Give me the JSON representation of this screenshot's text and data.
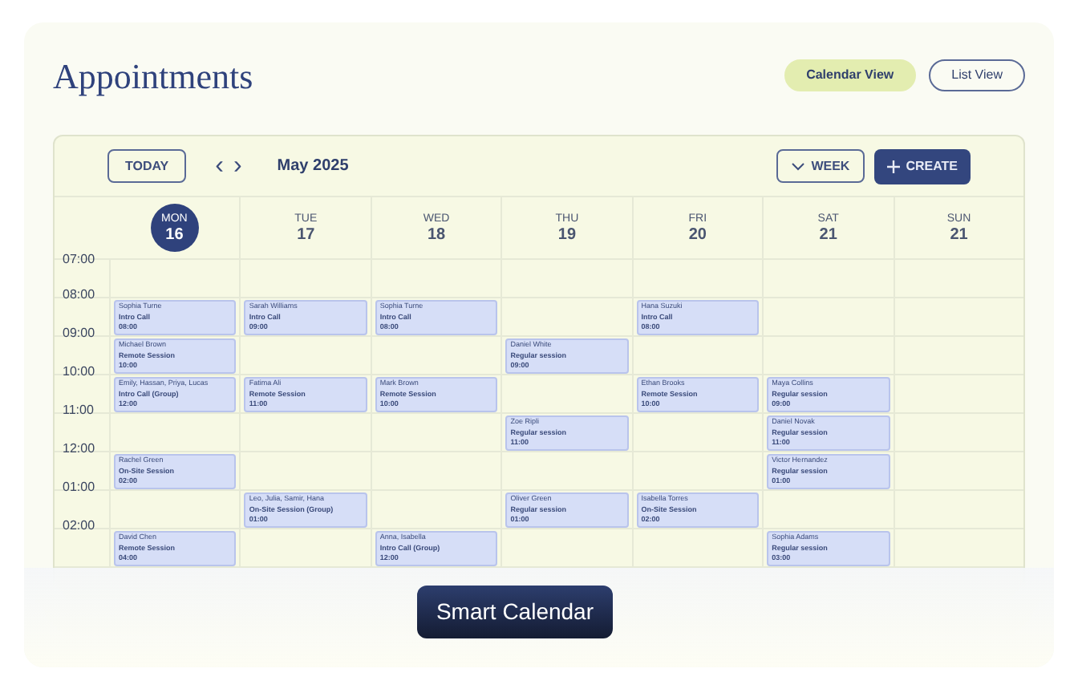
{
  "page": {
    "title": "Appointments"
  },
  "view_toggle": [
    {
      "label": "Calendar View",
      "selected": true
    },
    {
      "label": "List View",
      "selected": false
    }
  ],
  "toolbar": {
    "today": "TODAY",
    "prev": "‹",
    "next": "›",
    "month": "May 2025",
    "range": "WEEK",
    "create": "CREATE"
  },
  "days": [
    {
      "name": "MON",
      "date": "16",
      "selected": true
    },
    {
      "name": "TUE",
      "date": "17",
      "selected": false
    },
    {
      "name": "WED",
      "date": "18",
      "selected": false
    },
    {
      "name": "THU",
      "date": "19",
      "selected": false
    },
    {
      "name": "FRI",
      "date": "20",
      "selected": false
    },
    {
      "name": "SAT",
      "date": "21",
      "selected": false
    },
    {
      "name": "SUN",
      "date": "21",
      "selected": false
    }
  ],
  "time_rows": [
    {
      "time": "07:00",
      "slots": [
        {
          "kind": "empty"
        },
        {
          "kind": "empty"
        },
        {
          "kind": "empty"
        },
        {
          "kind": "empty"
        },
        {
          "kind": "empty"
        },
        {
          "kind": "empty"
        },
        {
          "kind": "empty"
        }
      ]
    },
    {
      "time": "08:00",
      "slots": [
        {
          "kind": "event",
          "name": "Sophia Turne",
          "type": "Intro Call",
          "time": "08:00"
        },
        {
          "kind": "event",
          "name": "Sarah Williams",
          "type": "Intro Call",
          "time": "09:00"
        },
        {
          "kind": "event",
          "name": "Sophia Turne",
          "type": "Intro Call",
          "time": "08:00"
        },
        {
          "kind": "empty"
        },
        {
          "kind": "event",
          "name": "Hana Suzuki",
          "type": "Intro Call",
          "time": "08:00"
        },
        {
          "kind": "empty"
        },
        {
          "kind": "empty"
        }
      ]
    },
    {
      "time": "09:00",
      "slots": [
        {
          "kind": "event",
          "name": "Michael Brown",
          "type": "Remote Session",
          "time": "10:00"
        },
        {
          "kind": "empty"
        },
        {
          "kind": "empty"
        },
        {
          "kind": "event",
          "name": "Daniel White",
          "type": "Regular session",
          "time": "09:00"
        },
        {
          "kind": "empty"
        },
        {
          "kind": "empty"
        },
        {
          "kind": "empty"
        }
      ]
    },
    {
      "time": "10:00",
      "slots": [
        {
          "kind": "event",
          "name": "Emily, Hassan, Priya, Lucas",
          "type": "Intro Call (Group)",
          "time": "12:00"
        },
        {
          "kind": "event",
          "name": "Fatima Ali",
          "type": "Remote Session",
          "time": "11:00"
        },
        {
          "kind": "event",
          "name": "Mark Brown",
          "type": "Remote Session",
          "time": "10:00"
        },
        {
          "kind": "empty"
        },
        {
          "kind": "event",
          "name": "Ethan Brooks",
          "type": "Remote Session",
          "time": "10:00"
        },
        {
          "kind": "event",
          "name": "Maya Collins",
          "type": "Regular session",
          "time": "09:00"
        },
        {
          "kind": "empty"
        }
      ]
    },
    {
      "time": "11:00",
      "slots": [
        {
          "kind": "empty"
        },
        {
          "kind": "empty"
        },
        {
          "kind": "empty"
        },
        {
          "kind": "event",
          "name": "Zoe Ripli",
          "type": "Regular session",
          "time": "11:00"
        },
        {
          "kind": "empty"
        },
        {
          "kind": "event",
          "name": "Daniel Novak",
          "type": "Regular session",
          "time": "11:00"
        },
        {
          "kind": "empty"
        }
      ]
    },
    {
      "time": "12:00",
      "slots": [
        {
          "kind": "event",
          "name": "Rachel Green",
          "type": "On-Site Session",
          "time": "02:00"
        },
        {
          "kind": "empty"
        },
        {
          "kind": "empty"
        },
        {
          "kind": "empty"
        },
        {
          "kind": "empty"
        },
        {
          "kind": "event",
          "name": "Victor Hernandez",
          "type": "Regular session",
          "time": "01:00"
        },
        {
          "kind": "empty"
        }
      ]
    },
    {
      "time": "01:00",
      "slots": [
        {
          "kind": "empty"
        },
        {
          "kind": "event",
          "name": "Leo, Julia, Samir, Hana",
          "type": "On-Site Session (Group)",
          "time": "01:00"
        },
        {
          "kind": "empty"
        },
        {
          "kind": "event",
          "name": "Oliver Green",
          "type": "Regular session",
          "time": "01:00"
        },
        {
          "kind": "event",
          "name": "Isabella Torres",
          "type": "On-Site Session",
          "time": "02:00"
        },
        {
          "kind": "empty"
        },
        {
          "kind": "empty"
        }
      ]
    },
    {
      "time": "02:00",
      "slots": [
        {
          "kind": "event",
          "name": "David Chen",
          "type": "Remote Session",
          "time": "04:00"
        },
        {
          "kind": "empty"
        },
        {
          "kind": "event",
          "name": "Anna, Isabella",
          "type": "Intro Call (Group)",
          "time": "12:00"
        },
        {
          "kind": "empty"
        },
        {
          "kind": "empty"
        },
        {
          "kind": "event",
          "name": "Sophia Adams",
          "type": "Regular session",
          "time": "03:00"
        },
        {
          "kind": "empty"
        }
      ]
    }
  ],
  "badge": "Smart Calendar"
}
